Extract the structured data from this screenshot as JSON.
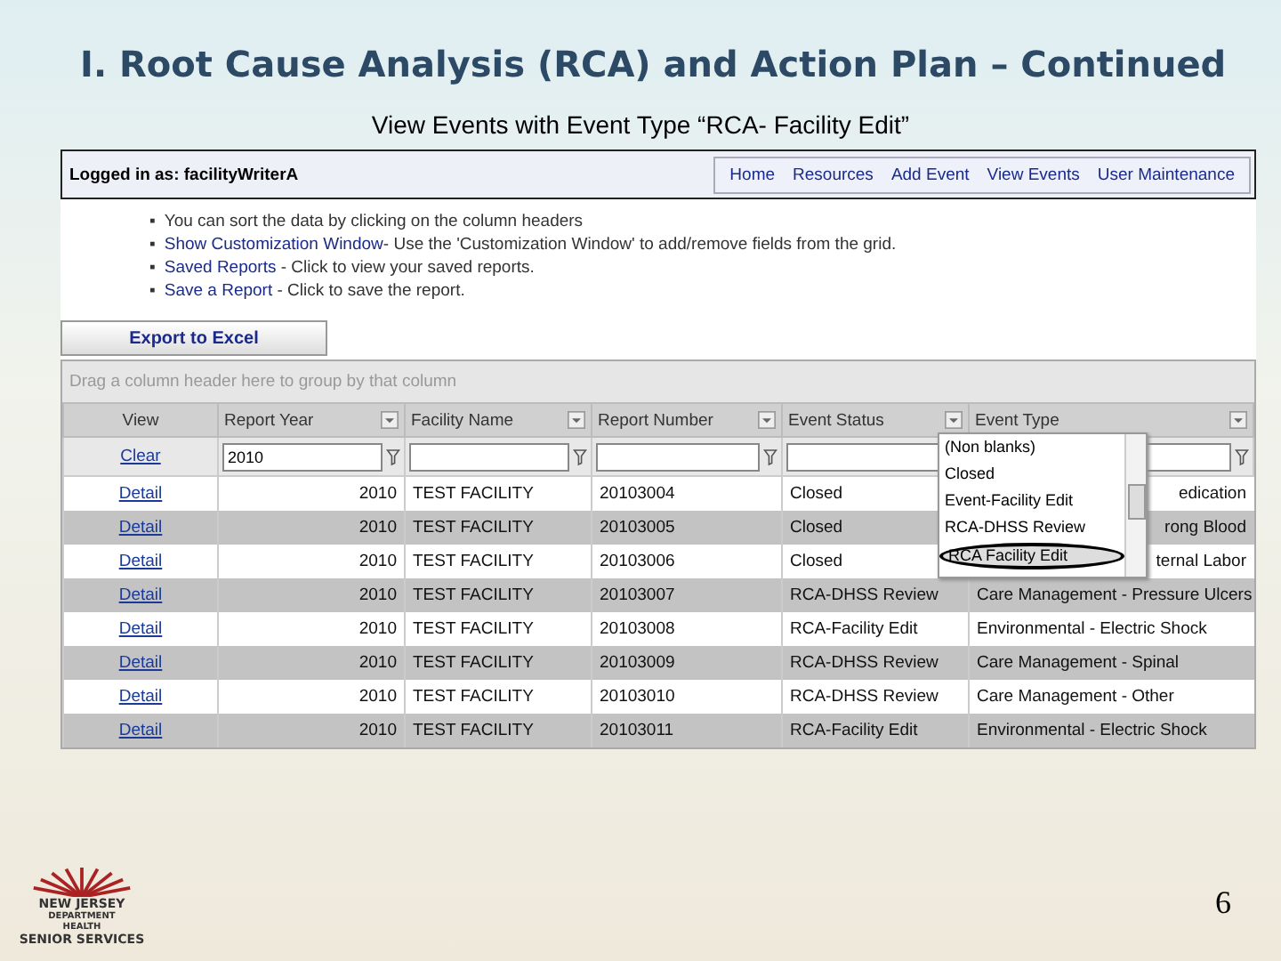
{
  "slide": {
    "title": "I.  Root Cause Analysis (RCA) and Action Plan – Continued",
    "subtitle": "View Events with Event Type “RCA- Facility Edit”",
    "page_number": "6",
    "logo": [
      "NEW JERSEY",
      "DEPARTMENT",
      "HEALTH",
      "SENIOR SERVICES"
    ]
  },
  "app": {
    "logged_in": "Logged in as: facilityWriterA",
    "nav": [
      "Home",
      "Resources",
      "Add Event",
      "View Events",
      "User Maintenance"
    ],
    "tips": [
      {
        "bullet": "▪",
        "text": "You can sort the data by clicking on the column headers"
      },
      {
        "bullet": "▪",
        "link": "Show Customization Window",
        "text": "-  Use the 'Customization Window' to add/remove fields from the grid."
      },
      {
        "bullet": "▪",
        "link": "Saved Reports",
        "text": " - Click to view your saved reports."
      },
      {
        "bullet": "▪",
        "link": "Save a Report",
        "text": " - Click to save the report."
      }
    ],
    "export_button": "Export to Excel",
    "group_panel": "Drag a column header here to group by that column",
    "columns": [
      {
        "label": "View",
        "filter": false
      },
      {
        "label": "Report Year",
        "filter": true,
        "filter_value": "2010"
      },
      {
        "label": "Facility Name",
        "filter": true
      },
      {
        "label": "Report Number",
        "filter": true
      },
      {
        "label": "Event Status",
        "filter": true,
        "filter_icon": false
      },
      {
        "label": "Event Type",
        "filter": true
      }
    ],
    "filter_row": {
      "clear": "Clear"
    },
    "rows": [
      [
        "Detail",
        "2010",
        "TEST FACILITY",
        "20103004",
        "Closed",
        "edication"
      ],
      [
        "Detail",
        "2010",
        "TEST FACILITY",
        "20103005",
        "Closed",
        "rong Blood"
      ],
      [
        "Detail",
        "2010",
        "TEST FACILITY",
        "20103006",
        "Closed",
        "ternal Labor"
      ],
      [
        "Detail",
        "2010",
        "TEST FACILITY",
        "20103007",
        "RCA-DHSS Review",
        "Care Management - Pressure Ulcers"
      ],
      [
        "Detail",
        "2010",
        "TEST FACILITY",
        "20103008",
        "RCA-Facility Edit",
        "Environmental - Electric Shock"
      ],
      [
        "Detail",
        "2010",
        "TEST FACILITY",
        "20103009",
        "RCA-DHSS Review",
        "Care Management - Spinal"
      ],
      [
        "Detail",
        "2010",
        "TEST FACILITY",
        "20103010",
        "RCA-DHSS Review",
        "Care Management - Other"
      ],
      [
        "Detail",
        "2010",
        "TEST FACILITY",
        "20103011",
        "RCA-Facility Edit",
        "Environmental - Electric Shock"
      ]
    ],
    "dropdown": [
      {
        "label": "(Non blanks)",
        "selected": false
      },
      {
        "label": "Closed",
        "selected": false
      },
      {
        "label": "Event-Facility Edit",
        "selected": false
      },
      {
        "label": "RCA-DHSS Review",
        "selected": false
      },
      {
        "label": "RCA Facility Edit",
        "selected": true
      }
    ]
  }
}
